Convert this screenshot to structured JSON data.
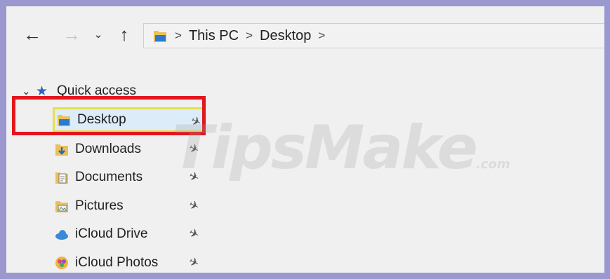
{
  "navigation": {
    "back_icon": "←",
    "forward_icon": "→",
    "recent_icon": "⌄",
    "up_icon": "↑"
  },
  "address_bar": {
    "breadcrumbs": [
      "This PC",
      "Desktop"
    ],
    "separator": ">"
  },
  "sidebar": {
    "quick_access_label": "Quick access",
    "items": [
      {
        "label": "Desktop",
        "icon": "desktop-folder-icon",
        "selected": true
      },
      {
        "label": "Downloads",
        "icon": "downloads-folder-icon"
      },
      {
        "label": "Documents",
        "icon": "documents-folder-icon"
      },
      {
        "label": "Pictures",
        "icon": "pictures-folder-icon"
      },
      {
        "label": "iCloud Drive",
        "icon": "icloud-drive-icon"
      },
      {
        "label": "iCloud Photos",
        "icon": "icloud-photos-icon"
      }
    ],
    "pin_icon": "✈"
  },
  "watermark": {
    "text": "TipsMake",
    "suffix": ".com"
  },
  "colors": {
    "highlight": "#e3161e",
    "selected_border": "#e8df4a",
    "selected_bg": "#dcecf8",
    "frame": "#9a98cf"
  }
}
